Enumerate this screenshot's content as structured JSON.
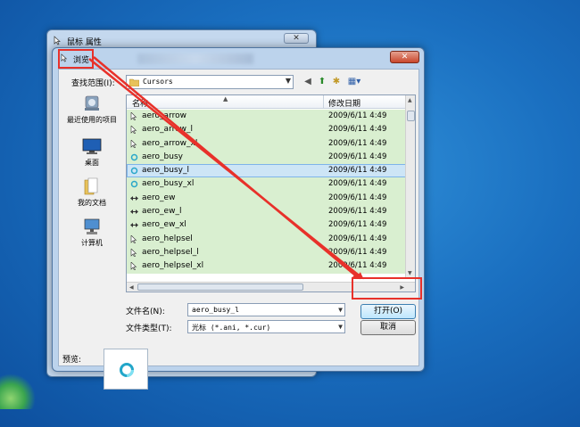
{
  "back_window": {
    "title": "鼠标 属性",
    "close_label": "✕"
  },
  "dialog": {
    "title": "浏览",
    "close_label": "✕",
    "lookin_label": "查找范围(I):",
    "lookin_value": "Cursors",
    "columns": {
      "name": "名称",
      "date": "修改日期"
    },
    "files": [
      {
        "name": "aero_arrow",
        "date": "2009/6/11 4:49",
        "icon": "arrow-cursor-icon"
      },
      {
        "name": "aero_arrow_l",
        "date": "2009/6/11 4:49",
        "icon": "arrow-cursor-icon"
      },
      {
        "name": "aero_arrow_xl",
        "date": "2009/6/11 4:49",
        "icon": "arrow-cursor-icon"
      },
      {
        "name": "aero_busy",
        "date": "2009/6/11 4:49",
        "icon": "busy-cursor-icon"
      },
      {
        "name": "aero_busy_l",
        "date": "2009/6/11 4:49",
        "icon": "busy-cursor-icon"
      },
      {
        "name": "aero_busy_xl",
        "date": "2009/6/11 4:49",
        "icon": "busy-cursor-icon"
      },
      {
        "name": "aero_ew",
        "date": "2009/6/11 4:49",
        "icon": "ew-resize-cursor-icon"
      },
      {
        "name": "aero_ew_l",
        "date": "2009/6/11 4:49",
        "icon": "ew-resize-cursor-icon"
      },
      {
        "name": "aero_ew_xl",
        "date": "2009/6/11 4:49",
        "icon": "ew-resize-cursor-icon"
      },
      {
        "name": "aero_helpsel",
        "date": "2009/6/11 4:49",
        "icon": "help-cursor-icon"
      },
      {
        "name": "aero_helpsel_l",
        "date": "2009/6/11 4:49",
        "icon": "help-cursor-icon"
      },
      {
        "name": "aero_helpsel_xl",
        "date": "2009/6/11 4:49",
        "icon": "help-cursor-icon"
      }
    ],
    "selected_index": 4,
    "places": [
      {
        "label": "最近使用的项目",
        "icon": "recent-items-icon"
      },
      {
        "label": "桌面",
        "icon": "desktop-icon"
      },
      {
        "label": "我的文档",
        "icon": "documents-icon"
      },
      {
        "label": "计算机",
        "icon": "computer-icon"
      }
    ],
    "filename_label": "文件名(N):",
    "filename_value": "aero_busy_l",
    "filetype_label": "文件类型(T):",
    "filetype_value": "光标 (*.ani, *.cur)",
    "open_label": "打开(O)",
    "cancel_label": "取消",
    "preview_label": "预览:"
  },
  "colors": {
    "highlight": "#e8312a",
    "list_green": "#d9efd0",
    "selection": "#cde5f6"
  }
}
